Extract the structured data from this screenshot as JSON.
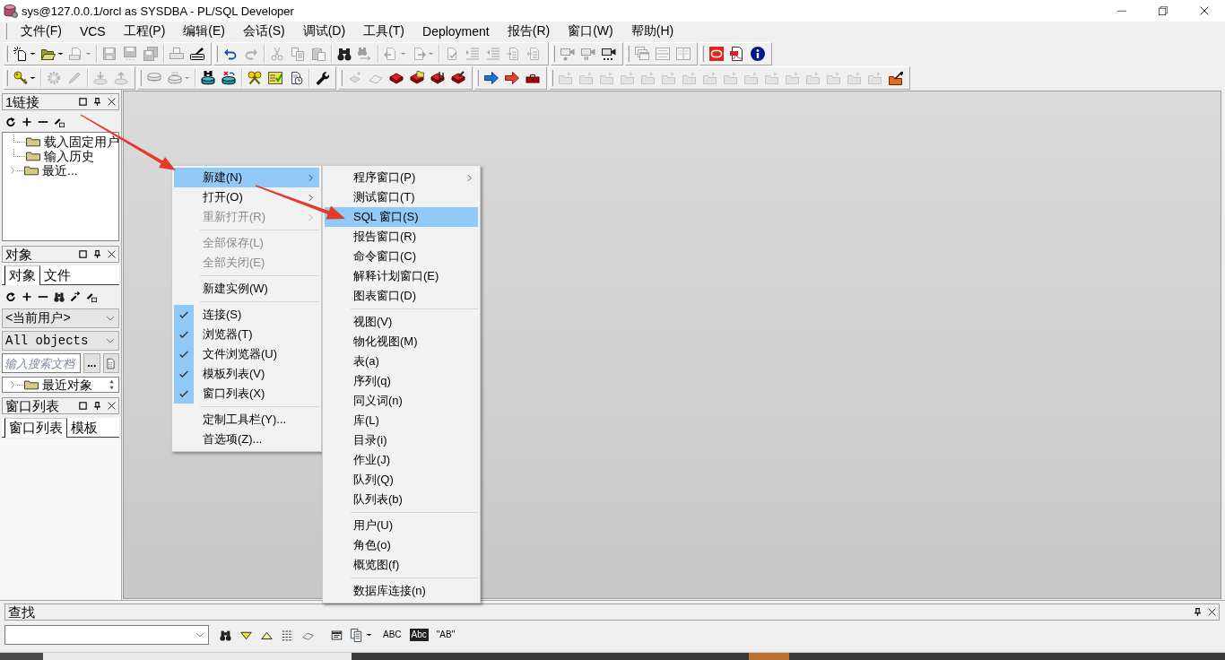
{
  "window": {
    "title": "sys@127.0.0.1/orcl as SYSDBA - PL/SQL Developer"
  },
  "menu_bar": [
    "文件(F)",
    "VCS",
    "工程(P)",
    "编辑(E)",
    "会话(S)",
    "调试(D)",
    "工具(T)",
    "Deployment",
    "报告(R)",
    "窗口(W)",
    "帮助(H)"
  ],
  "toolbar_rows": [
    {
      "toolbars": [
        {
          "groups": [
            {
              "buttons": [
                {
                  "disabled": false
                },
                {
                  "disabled": false
                },
                {
                  "disabled": true
                }
              ]
            },
            {
              "buttons": [
                {
                  "disabled": true
                },
                {
                  "disabled": true
                },
                {
                  "disabled": true
                }
              ]
            },
            {
              "buttons": [
                {
                  "disabled": true
                },
                {
                  "disabled": false
                }
              ]
            }
          ]
        },
        {
          "groups": [
            {
              "buttons": [
                {
                  "disabled": false
                },
                {
                  "disabled": true
                }
              ]
            },
            {
              "buttons": [
                {
                  "disabled": true
                },
                {
                  "disabled": true
                },
                {
                  "disabled": true
                }
              ]
            },
            {
              "buttons": [
                {
                  "disabled": false
                },
                {
                  "disabled": true
                }
              ]
            },
            {
              "buttons": [
                {
                  "disabled": true
                },
                {
                  "disabled": true
                }
              ]
            },
            {
              "buttons": [
                {
                  "disabled": true
                },
                {
                  "disabled": true
                },
                {
                  "disabled": true
                },
                {
                  "disabled": true
                },
                {
                  "disabled": true
                }
              ]
            }
          ]
        },
        {
          "groups": [
            {
              "buttons": [
                {
                  "disabled": true
                },
                {
                  "disabled": true
                },
                {
                  "disabled": false
                }
              ]
            }
          ]
        },
        {
          "groups": [
            {
              "buttons": [
                {
                  "disabled": true
                },
                {
                  "disabled": true
                },
                {
                  "disabled": true
                }
              ]
            }
          ]
        },
        {
          "groups": [
            {
              "buttons": [
                {
                  "disabled": false
                },
                {
                  "disabled": false
                },
                {
                  "disabled": false
                }
              ]
            }
          ]
        }
      ]
    },
    {
      "toolbars": [
        {
          "groups": [
            {
              "buttons": [
                {
                  "disabled": false
                }
              ]
            },
            {
              "buttons": [
                {
                  "disabled": true
                },
                {
                  "disabled": true
                }
              ]
            },
            {
              "buttons": [
                {
                  "disabled": true
                },
                {
                  "disabled": true
                }
              ]
            }
          ]
        },
        {
          "groups": [
            {
              "buttons": [
                {
                  "disabled": true
                },
                {
                  "disabled": true
                }
              ]
            },
            {
              "buttons": [
                {
                  "disabled": false
                },
                {
                  "disabled": false
                }
              ]
            },
            {
              "buttons": [
                {
                  "disabled": false
                },
                {
                  "disabled": false
                },
                {
                  "disabled": false
                }
              ]
            },
            {
              "buttons": [
                {
                  "disabled": false
                }
              ]
            }
          ]
        },
        {
          "groups": [
            {
              "buttons": [
                {
                  "disabled": true
                },
                {
                  "disabled": true
                },
                {
                  "disabled": false
                },
                {
                  "disabled": false
                },
                {
                  "disabled": false
                },
                {
                  "disabled": false
                }
              ]
            }
          ]
        },
        {
          "groups": [
            {
              "buttons": [
                {
                  "disabled": false
                },
                {
                  "disabled": false
                },
                {
                  "disabled": false
                }
              ]
            }
          ]
        },
        {
          "groups": [
            {
              "buttons": [
                {
                  "disabled": true
                },
                {
                  "disabled": true
                },
                {
                  "disabled": true
                },
                {
                  "disabled": true
                },
                {
                  "disabled": true
                },
                {
                  "disabled": true
                },
                {
                  "disabled": true
                },
                {
                  "disabled": true
                },
                {
                  "disabled": true
                },
                {
                  "disabled": true
                },
                {
                  "disabled": true
                },
                {
                  "disabled": true
                },
                {
                  "disabled": true
                },
                {
                  "disabled": true
                },
                {
                  "disabled": true
                },
                {
                  "disabled": true
                },
                {
                  "disabled": false
                }
              ]
            }
          ]
        }
      ]
    }
  ],
  "connections_panel": {
    "title": "1链接",
    "tree": [
      {
        "label": "载入固定用户",
        "expandable": false
      },
      {
        "label": "输入历史",
        "expandable": false
      },
      {
        "label": "最近...",
        "expandable": true
      }
    ]
  },
  "objects_panel": {
    "title": "对象",
    "tabs": [
      {
        "label": "对象",
        "selected": true
      },
      {
        "label": "文件",
        "selected": false
      }
    ],
    "owner": "<当前用户>",
    "object_filter": "All objects",
    "search": {
      "placeholder": "输入搜索文档",
      "button": "..."
    },
    "tree": [
      {
        "label": "最近对象",
        "expandable": true
      }
    ]
  },
  "window_list_panel": {
    "title": "窗口列表",
    "tabs": [
      {
        "label": "窗口列表",
        "selected": true
      },
      {
        "label": "模板",
        "selected": false
      }
    ]
  },
  "context_menu": {
    "items": [
      {
        "kind": "item",
        "label": "新建(N)",
        "selected": true,
        "disabled": false,
        "checked": false,
        "submenu": true
      },
      {
        "kind": "item",
        "label": "打开(O)",
        "selected": false,
        "disabled": false,
        "checked": false,
        "submenu": true
      },
      {
        "kind": "item",
        "label": "重新打开(R)",
        "selected": false,
        "disabled": true,
        "checked": false,
        "submenu": true
      },
      {
        "kind": "separator"
      },
      {
        "kind": "item",
        "label": "全部保存(L)",
        "selected": false,
        "disabled": true,
        "checked": false,
        "submenu": false
      },
      {
        "kind": "item",
        "label": "全部关闭(E)",
        "selected": false,
        "disabled": true,
        "checked": false,
        "submenu": false
      },
      {
        "kind": "separator"
      },
      {
        "kind": "item",
        "label": "新建实例(W)",
        "selected": false,
        "disabled": false,
        "checked": false,
        "submenu": false
      },
      {
        "kind": "separator"
      },
      {
        "kind": "item",
        "label": "连接(S)",
        "selected": false,
        "disabled": false,
        "checked": true,
        "submenu": false
      },
      {
        "kind": "item",
        "label": "浏览器(T)",
        "selected": false,
        "disabled": false,
        "checked": true,
        "submenu": false
      },
      {
        "kind": "item",
        "label": "文件浏览器(U)",
        "selected": false,
        "disabled": false,
        "checked": true,
        "submenu": false
      },
      {
        "kind": "item",
        "label": "模板列表(V)",
        "selected": false,
        "disabled": false,
        "checked": true,
        "submenu": false
      },
      {
        "kind": "item",
        "label": "窗口列表(X)",
        "selected": false,
        "disabled": false,
        "checked": true,
        "submenu": false
      },
      {
        "kind": "separator"
      },
      {
        "kind": "item",
        "label": "定制工具栏(Y)...",
        "selected": false,
        "disabled": false,
        "checked": false,
        "submenu": false
      },
      {
        "kind": "item",
        "label": "首选项(Z)...",
        "selected": false,
        "disabled": false,
        "checked": false,
        "submenu": false
      }
    ]
  },
  "submenu": {
    "items": [
      {
        "kind": "item",
        "label": "程序窗口(P)",
        "selected": false,
        "submenu": true
      },
      {
        "kind": "item",
        "label": "测试窗口(T)",
        "selected": false,
        "submenu": false
      },
      {
        "kind": "item",
        "label": "SQL 窗口(S)",
        "selected": true,
        "submenu": false
      },
      {
        "kind": "item",
        "label": "报告窗口(R)",
        "selected": false,
        "submenu": false
      },
      {
        "kind": "item",
        "label": "命令窗口(C)",
        "selected": false,
        "submenu": false
      },
      {
        "kind": "item",
        "label": "解释计划窗口(E)",
        "selected": false,
        "submenu": false
      },
      {
        "kind": "item",
        "label": "图表窗口(D)",
        "selected": false,
        "submenu": false
      },
      {
        "kind": "separator"
      },
      {
        "kind": "item",
        "label": "视图(V)",
        "selected": false,
        "submenu": false
      },
      {
        "kind": "item",
        "label": "物化视图(M)",
        "selected": false,
        "submenu": false
      },
      {
        "kind": "item",
        "label": "表(a)",
        "selected": false,
        "submenu": false
      },
      {
        "kind": "item",
        "label": "序列(q)",
        "selected": false,
        "submenu": false
      },
      {
        "kind": "item",
        "label": "同义词(n)",
        "selected": false,
        "submenu": false
      },
      {
        "kind": "item",
        "label": "库(L)",
        "selected": false,
        "submenu": false
      },
      {
        "kind": "item",
        "label": "目录(i)",
        "selected": false,
        "submenu": false
      },
      {
        "kind": "item",
        "label": "作业(J)",
        "selected": false,
        "submenu": false
      },
      {
        "kind": "item",
        "label": "队列(Q)",
        "selected": false,
        "submenu": false
      },
      {
        "kind": "item",
        "label": "队列表(b)",
        "selected": false,
        "submenu": false
      },
      {
        "kind": "separator"
      },
      {
        "kind": "item",
        "label": "用户(U)",
        "selected": false,
        "submenu": false
      },
      {
        "kind": "item",
        "label": "角色(o)",
        "selected": false,
        "submenu": false
      },
      {
        "kind": "item",
        "label": "概览图(f)",
        "selected": false,
        "submenu": false
      },
      {
        "kind": "separator"
      },
      {
        "kind": "item",
        "label": "数据库连接(n)",
        "selected": false,
        "submenu": false
      }
    ]
  },
  "find_panel": {
    "title": "查找",
    "options": [
      {
        "label": "ABC",
        "kind": "plain"
      },
      {
        "label": "Abc",
        "kind": "inverse"
      },
      {
        "label": "\"AB\"",
        "kind": "plain"
      }
    ]
  }
}
